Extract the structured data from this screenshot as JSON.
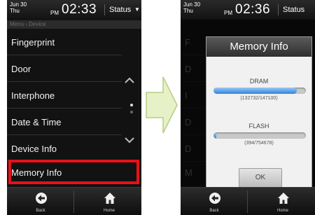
{
  "left_screen": {
    "status_bar": {
      "date_day": "Jun  30",
      "date_weekday": "Thu",
      "ampm": "PM",
      "time": "02:33",
      "status_label": "Status"
    },
    "breadcrumb": "Menu  ›  Device",
    "menu_items": [
      {
        "label": "Fingerprint"
      },
      {
        "label": "Door"
      },
      {
        "label": "Interphone"
      },
      {
        "label": "Date & Time"
      },
      {
        "label": "Device Info"
      },
      {
        "label": "Memory Info"
      }
    ],
    "highlight_color": "#e8101a",
    "nav": {
      "back_label": "Back",
      "home_label": "Home"
    }
  },
  "right_screen": {
    "status_bar": {
      "date_day": "Jun  30",
      "date_weekday": "Thu",
      "ampm": "PM",
      "time": "02:36",
      "status_label": "Status"
    },
    "background_items_initials": [
      "F",
      "D",
      "I",
      "D",
      "D",
      "M"
    ],
    "dialog": {
      "title": "Memory Info",
      "dram": {
        "label": "DRAM",
        "used": 132732,
        "total": 147100,
        "text": "(132732/147100)"
      },
      "flash": {
        "label": "FLASH",
        "used": 394,
        "total": 754678,
        "text": "(394/754678)"
      },
      "ok_label": "OK"
    },
    "nav": {
      "back_label": "Back",
      "home_label": "Home"
    }
  },
  "arrow_color": "#e7f1c8"
}
